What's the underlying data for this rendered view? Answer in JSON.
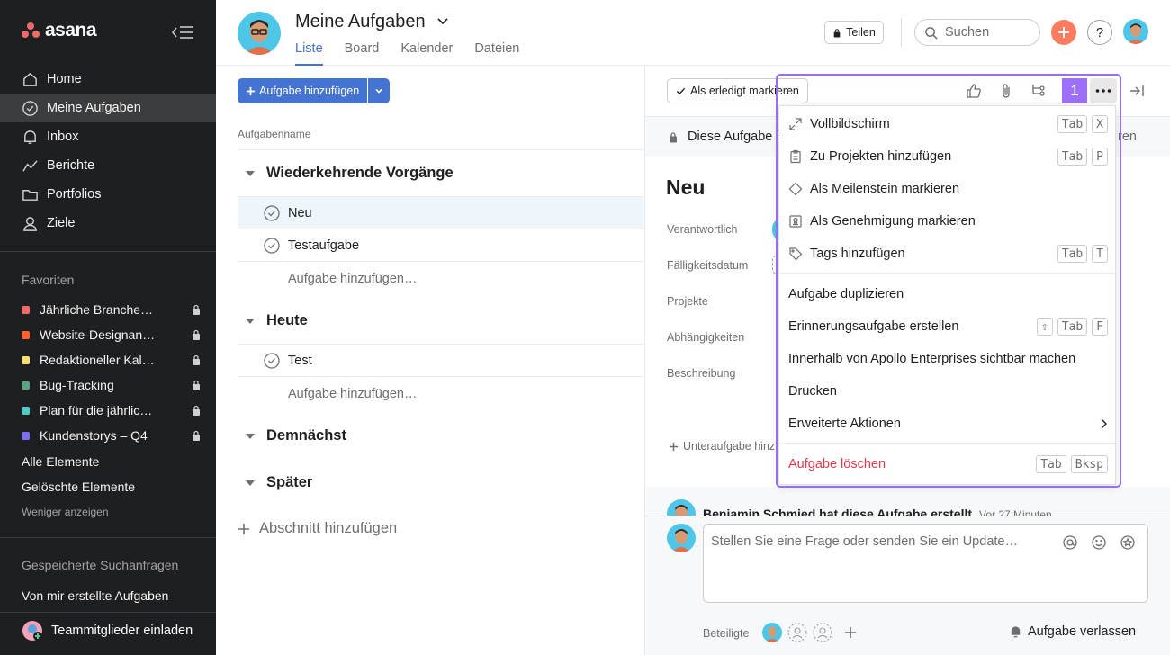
{
  "brand": {
    "name": "asana"
  },
  "sidebar": {
    "nav": [
      {
        "label": "Home",
        "icon": "home-icon"
      },
      {
        "label": "Meine Aufgaben",
        "icon": "check-circle-icon",
        "active": true
      },
      {
        "label": "Inbox",
        "icon": "bell-icon"
      },
      {
        "label": "Berichte",
        "icon": "line-chart-icon"
      },
      {
        "label": "Portfolios",
        "icon": "folder-icon"
      },
      {
        "label": "Ziele",
        "icon": "person-icon"
      }
    ],
    "favorites_heading": "Favoriten",
    "favorites": [
      {
        "label": "Jährliche Branche…",
        "color": "#f06a6a"
      },
      {
        "label": "Website-Designan…",
        "color": "#fd612c"
      },
      {
        "label": "Redaktioneller Kal…",
        "color": "#f8df72"
      },
      {
        "label": "Bug-Tracking",
        "color": "#5da283"
      },
      {
        "label": "Plan für die jährlic…",
        "color": "#4ecbc4"
      },
      {
        "label": "Kundenstorys – Q4",
        "color": "#7a6ff0"
      }
    ],
    "all_items": "Alle Elemente",
    "deleted_items": "Gelöschte Elemente",
    "show_less": "Weniger anzeigen",
    "saved_searches_heading": "Gespeicherte Suchanfragen",
    "saved_search": "Von mir erstellte Aufgaben",
    "invite": "Teammitglieder einladen"
  },
  "header": {
    "title": "Meine Aufgaben",
    "tabs": [
      "Liste",
      "Board",
      "Kalender",
      "Dateien"
    ],
    "share": "Teilen",
    "search_placeholder": "Suchen",
    "help": "?"
  },
  "list": {
    "add_task": "Aufgabe hinzufügen",
    "column_header": "Aufgabenname",
    "sections": [
      {
        "title": "Wiederkehrende Vorgänge",
        "tasks": [
          "Neu",
          "Testaufgabe"
        ]
      },
      {
        "title": "Heute",
        "tasks": [
          "Test"
        ]
      },
      {
        "title": "Demnächst",
        "tasks": []
      },
      {
        "title": "Später",
        "tasks": []
      }
    ],
    "add_task_inline": "Aufgabe hinzufügen…",
    "add_section": "Abschnitt hinzufügen"
  },
  "detail": {
    "mark_done": "Als erledigt markieren",
    "lock_notice": "Diese Aufgabe i",
    "lock_notice_right": "ren",
    "task_title": "Neu",
    "fields": [
      "Verantwortlich",
      "Fälligkeitsdatum",
      "Projekte",
      "Abhängigkeiten",
      "Beschreibung"
    ],
    "add_subtask": "Unteraufgabe hinz",
    "activity": "Benjamin Schmied hat diese Aufgabe erstellt",
    "activity_time": "Vor 27 Minuten",
    "comment_placeholder": "Stellen Sie eine Frage oder senden Sie ein Update…",
    "collaborators_label": "Beteiligte",
    "leave_task": "Aufgabe verlassen",
    "badge": "1"
  },
  "menu": {
    "items": [
      {
        "label": "Vollbildschirm",
        "icon": "expand-icon",
        "keys": [
          "Tab",
          "X"
        ]
      },
      {
        "label": "Zu Projekten hinzufügen",
        "icon": "clipboard-icon",
        "keys": [
          "Tab",
          "P"
        ]
      },
      {
        "label": "Als Meilenstein markieren",
        "icon": "diamond-icon",
        "keys": []
      },
      {
        "label": "Als Genehmigung markieren",
        "icon": "approval-icon",
        "keys": []
      },
      {
        "label": "Tags hinzufügen",
        "icon": "tag-icon",
        "keys": [
          "Tab",
          "T"
        ]
      },
      {
        "label": "Aufgabe duplizieren",
        "keys": []
      },
      {
        "label": "Erinnerungsaufgabe erstellen",
        "keys": [
          "⇧",
          "Tab",
          "F"
        ]
      },
      {
        "label": "Innerhalb von Apollo Enterprises sichtbar machen",
        "keys": []
      },
      {
        "label": "Drucken",
        "keys": []
      },
      {
        "label": "Erweiterte Aktionen",
        "keys": []
      },
      {
        "label": "Aufgabe löschen",
        "keys": [
          "Tab",
          "Bksp"
        ],
        "color": "#e8384f"
      }
    ]
  },
  "colors": {
    "accent": "#4573d2",
    "sidebar_bg": "#1e1f21",
    "highlight": "#9b6bf2",
    "danger": "#e8384f"
  }
}
